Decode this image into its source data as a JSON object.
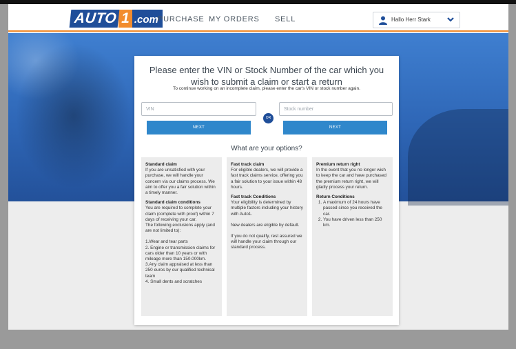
{
  "header": {
    "logo": {
      "auto": "AUTO",
      "one": "1",
      "com": ".com"
    },
    "nav": [
      "PURCHASE",
      "MY ORDERS",
      "SELL"
    ],
    "user_greeting": "Hallo Herr Stark"
  },
  "card": {
    "title": "Please enter the VIN or Stock Number of the car which you wish to submit a claim or start a return",
    "subtitle": "To continue working on an incomplete claim, please enter the car's VIN or stock number again.",
    "vin_placeholder": "VIN",
    "stock_placeholder": "Stock number",
    "or_label": "OR",
    "next_label": "NEXT",
    "options_heading": "What are your options?"
  },
  "options": {
    "standard": {
      "title": "Standard claim",
      "text": "If you are unsatisfied with your purchase, we will handle your concern via our claims process. We aim to offer you a fair solution within a timely manner.",
      "conditions_title": "Standard claim conditions",
      "conditions_text": "You are required to complete your claim (complete with proof) within 7 days of receiving your car.",
      "exclusions_intro": "The following exclusions apply (and are not limited to):",
      "exclusions": [
        "1.Wear and tear parts",
        "2. Engine or transmission claims for cars older than 10 years or with mileage more than 150.000km.",
        "3.Any claim appraised at less than 250 euros by our qualified technical team",
        "4. Small dents and scratches"
      ]
    },
    "fast": {
      "title": "Fast track claim",
      "text": "For eligible dealers, we will provide a fast track claims service, offering you a fair solution to your issue within 48 hours.",
      "conditions_title": "Fast track Conditions",
      "conditions_text": "Your eligibility is determined by multiple factors including your history with Auto1.",
      "new_dealers": "New dealers are eligible by default.",
      "not_qualify": "If you do not qualify, rest assured we will handle your claim through our standard process."
    },
    "premium": {
      "title": "Premium return right",
      "text": "In the event that you no longer wish to keep the car and have purchased the premium return right, we will gladly process your return.",
      "conditions_title": "Return Conditions",
      "conditions": [
        "A maximum of 24 hours have passed since you received the car.",
        "You have driven less than 250 km."
      ]
    }
  },
  "colors": {
    "brand_blue": "#1f4e99",
    "brand_orange": "#f28c2e",
    "button_blue": "#2f87cb"
  }
}
